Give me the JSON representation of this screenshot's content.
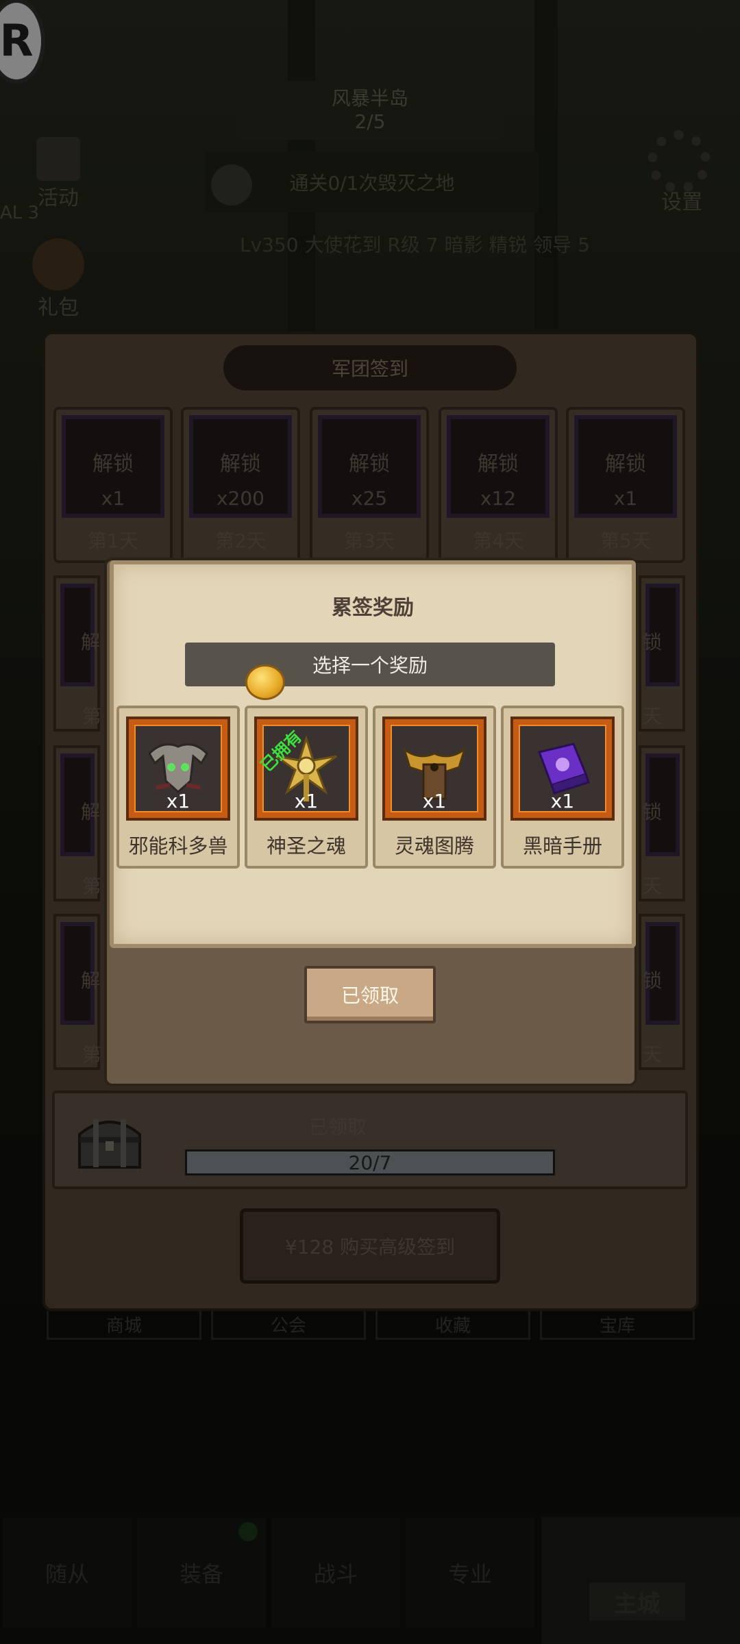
{
  "background": {
    "stage_name": "风暴半岛",
    "stage_progress": "2/5",
    "quest_text": "通关0/1次毁灭之地",
    "news_text": "Lv350 大使花到 R级 7 暗影 精锐 领导 5",
    "left_icons": [
      {
        "label": "活动",
        "icon": "event-icon"
      },
      {
        "label": "礼包",
        "icon": "gift-icon"
      }
    ],
    "left_badge": "AL 3",
    "settings_label": "设置"
  },
  "legion_signin": {
    "title": "军团签到",
    "unlock_text": "解锁",
    "days": [
      {
        "label": "第1天",
        "qty": "x1"
      },
      {
        "label": "第2天",
        "qty": "x200"
      },
      {
        "label": "第3天",
        "qty": "x25"
      },
      {
        "label": "第4天",
        "qty": "x12"
      },
      {
        "label": "第5天",
        "qty": "x1"
      }
    ],
    "row_left_labels": [
      "第",
      "第",
      "第"
    ],
    "row_right_labels": [
      "天",
      "天",
      "天"
    ],
    "row_left_unlock": "解",
    "row_right_unlock": "锁",
    "chest_status": "已领取",
    "progress_text": "20/7",
    "progress_fraction": 1.0,
    "buy_button": "¥128 购买高级签到"
  },
  "sub_tabs": [
    "商城",
    "公会",
    "收藏",
    "宝库"
  ],
  "bottom_nav": {
    "items": [
      "随从",
      "装备",
      "战斗",
      "专业"
    ],
    "main": "主城"
  },
  "reward_popup": {
    "title": "累签奖励",
    "select_text": "选择一个奖励",
    "owned_tag": "已拥有",
    "rewards": [
      {
        "name": "邪能科多兽",
        "qty": "x1",
        "icon": "fel-kodo-mount-icon"
      },
      {
        "name": "神圣之魂",
        "qty": "x1",
        "icon": "holy-soul-icon"
      },
      {
        "name": "灵魂图腾",
        "qty": "x1",
        "icon": "soul-totem-icon"
      },
      {
        "name": "黑暗手册",
        "qty": "x1",
        "icon": "dark-tome-icon"
      }
    ],
    "claimed_button": "已领取"
  }
}
